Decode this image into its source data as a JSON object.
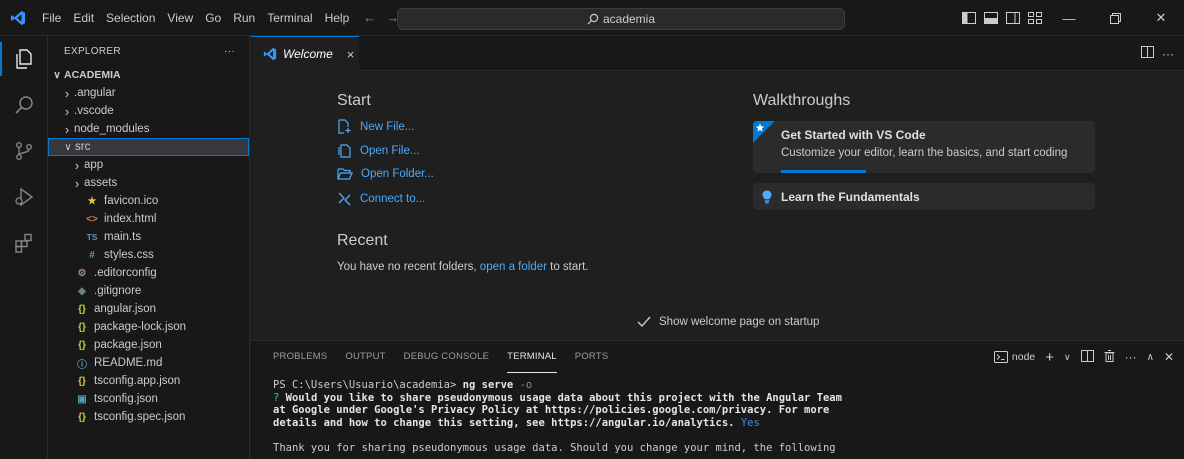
{
  "titlebar": {
    "menu": [
      "File",
      "Edit",
      "Selection",
      "View",
      "Go",
      "Run",
      "Terminal",
      "Help"
    ],
    "search_text": "academia",
    "colors": {
      "accent": "#0078d4",
      "logo": "#3794ff"
    }
  },
  "explorer": {
    "header": "EXPLORER",
    "more": "···",
    "root": "ACADEMIA",
    "items": [
      {
        "label": ".angular",
        "kind": "folder",
        "twisty": ">",
        "icon": ""
      },
      {
        "label": ".vscode",
        "kind": "folder",
        "twisty": ">",
        "icon": ""
      },
      {
        "label": "node_modules",
        "kind": "folder",
        "twisty": ">",
        "icon": ""
      },
      {
        "label": "src",
        "kind": "folder-open",
        "twisty": "v",
        "icon": ""
      },
      {
        "label": "app",
        "kind": "folder",
        "twisty": ">",
        "icon": ""
      },
      {
        "label": "assets",
        "kind": "folder",
        "twisty": ">",
        "icon": ""
      },
      {
        "label": "favicon.ico",
        "kind": "file",
        "twisty": "",
        "icon": "★"
      },
      {
        "label": "index.html",
        "kind": "file",
        "twisty": "",
        "icon": "<>"
      },
      {
        "label": "main.ts",
        "kind": "file",
        "twisty": "",
        "icon": "TS"
      },
      {
        "label": "styles.css",
        "kind": "file",
        "twisty": "",
        "icon": "#"
      },
      {
        "label": ".editorconfig",
        "kind": "file",
        "twisty": "",
        "icon": "⚙"
      },
      {
        "label": ".gitignore",
        "kind": "file",
        "twisty": "",
        "icon": "◆"
      },
      {
        "label": "angular.json",
        "kind": "file",
        "twisty": "",
        "icon": "{}"
      },
      {
        "label": "package-lock.json",
        "kind": "file",
        "twisty": "",
        "icon": "{}"
      },
      {
        "label": "package.json",
        "kind": "file",
        "twisty": "",
        "icon": "{}"
      },
      {
        "label": "README.md",
        "kind": "file",
        "twisty": "",
        "icon": "ⓘ"
      },
      {
        "label": "tsconfig.app.json",
        "kind": "file",
        "twisty": "",
        "icon": "{}"
      },
      {
        "label": "tsconfig.json",
        "kind": "file",
        "twisty": "",
        "icon": "▣"
      },
      {
        "label": "tsconfig.spec.json",
        "kind": "file",
        "twisty": "",
        "icon": "{}"
      }
    ]
  },
  "tabs": {
    "active_label": "Welcome",
    "close": "×",
    "more": "···"
  },
  "welcome": {
    "start_title": "Start",
    "start_links": [
      "New File...",
      "Open File...",
      "Open Folder...",
      "Connect to..."
    ],
    "recent_title": "Recent",
    "recent_prefix": "You have no recent folders,",
    "recent_link": "open a folder",
    "recent_suffix": "to start.",
    "walk_title": "Walkthroughs",
    "walk_cards": [
      {
        "title": "Get Started with VS Code",
        "desc": "Customize your editor, learn the basics, and start coding"
      },
      {
        "title": "Learn the Fundamentals"
      }
    ],
    "walk_progress": 0.27,
    "show_on_startup": "Show welcome page on startup"
  },
  "panel": {
    "tabs": [
      "PROBLEMS",
      "OUTPUT",
      "DEBUG CONSOLE",
      "TERMINAL",
      "PORTS"
    ],
    "active_tab": "TERMINAL",
    "terminal_name": "node",
    "more": "···",
    "terminal": {
      "prompt": "PS C:\\Users\\Usuario\\academia> ",
      "command": "ng serve",
      "flag": "-o",
      "question_mark": "?",
      "question_lines": [
        "Would you like to share pseudonymous usage data about this project with the Angular Team",
        "at Google under Google's Privacy Policy at https://policies.google.com/privacy. For more",
        "details and how to change this setting, see https://angular.io/analytics."
      ],
      "answer": "Yes",
      "after": "Thank you for sharing pseudonymous usage data. Should you change your mind, the following"
    }
  }
}
